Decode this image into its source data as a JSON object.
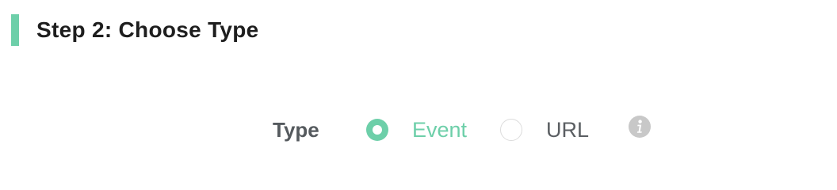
{
  "header": {
    "title": "Step 2: Choose Type",
    "accent_color": "#6dcfa9"
  },
  "type_field": {
    "label": "Type",
    "selected": "Event",
    "options": [
      {
        "label": "Event",
        "checked": true
      },
      {
        "label": "URL",
        "checked": false
      }
    ],
    "info_icon": "info-icon"
  }
}
